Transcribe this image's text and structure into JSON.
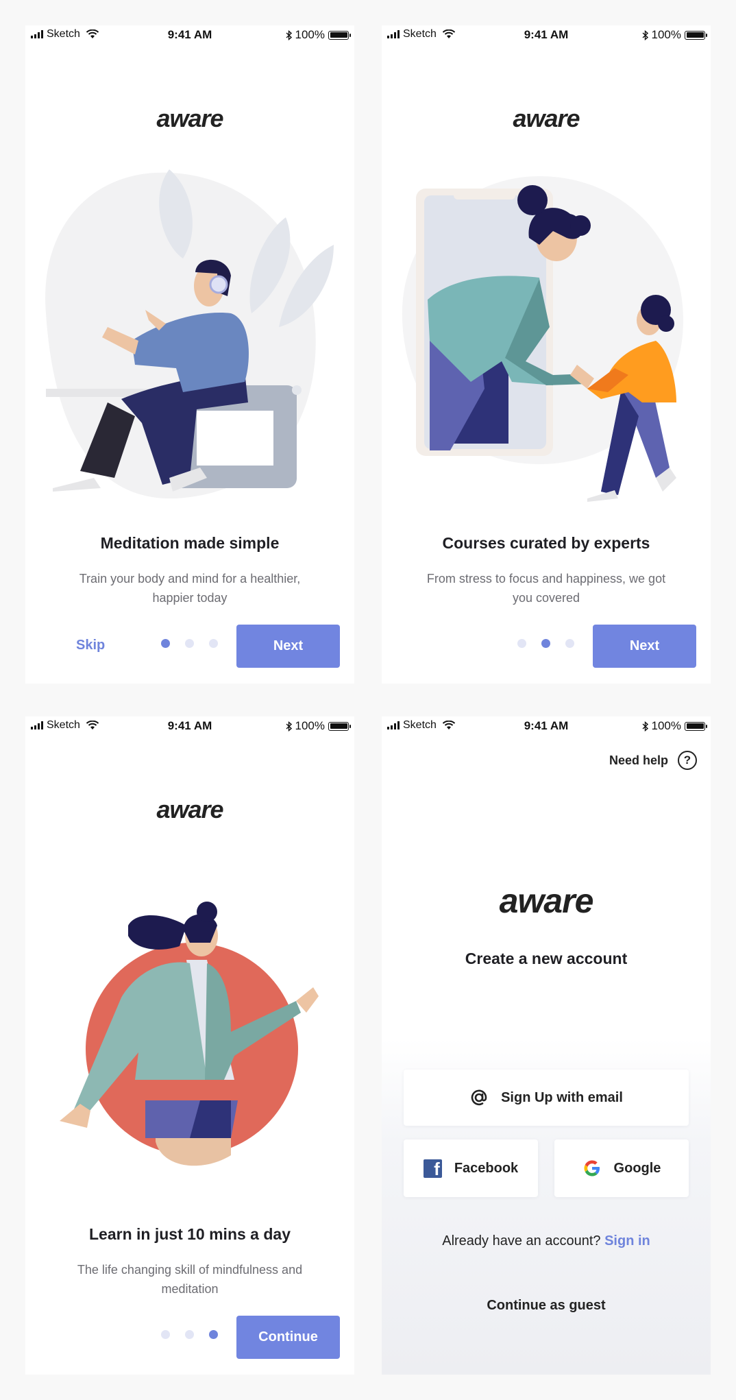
{
  "status_bar": {
    "carrier": "Sketch",
    "time": "9:41 AM",
    "battery": "100%"
  },
  "app": {
    "logo": "aware"
  },
  "onboarding": [
    {
      "title": "Meditation made simple",
      "subtitle": "Train your body and mind for a healthier, happier today",
      "skip_label": "Skip",
      "button_label": "Next",
      "active_dot": 1
    },
    {
      "title": "Courses curated by experts",
      "subtitle": "From stress to focus and happiness, we got you covered",
      "button_label": "Next",
      "active_dot": 2
    },
    {
      "title": "Learn in just 10 mins a day",
      "subtitle": "The life changing skill of mindfulness and meditation",
      "button_label": "Continue",
      "active_dot": 3
    }
  ],
  "auth": {
    "help_label": "Need help",
    "heading": "Create a new account",
    "email_button": "Sign Up with email",
    "facebook_button": "Facebook",
    "google_button": "Google",
    "signin_prompt": "Already have an account?",
    "signin_link": "Sign in",
    "guest_label": "Continue as guest"
  },
  "colors": {
    "accent": "#7185e0",
    "dot_inactive": "#e2e5f5",
    "text_dark": "#1f1f24",
    "text_muted": "#6c6c72"
  },
  "icons": [
    "signal-icon",
    "wifi-icon",
    "bluetooth-icon",
    "battery-icon",
    "help-icon",
    "at-sign-icon",
    "facebook-icon",
    "google-icon"
  ]
}
